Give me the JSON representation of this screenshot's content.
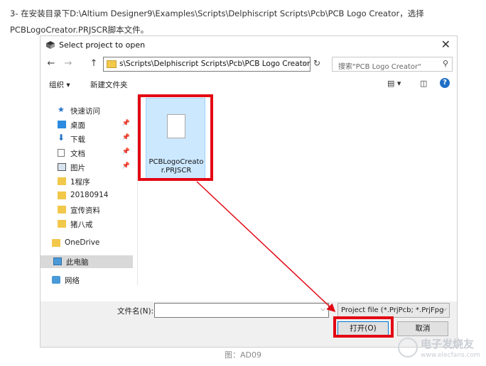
{
  "instruction": {
    "line1": "3- 在安装目录下D:\\Altium Designer9\\Examples\\Scripts\\Delphiscript Scripts\\Pcb\\PCB Logo Creator，选择",
    "line2": "PCBLogoCreator.PRJSCR脚本文件。"
  },
  "dialog": {
    "title": "Select project to open",
    "close_symbol": "✕",
    "nav": {
      "back": "←",
      "forward": "→",
      "up": "↑"
    },
    "address": "s\\Scripts\\Delphiscript Scripts\\Pcb\\PCB Logo Creator",
    "search_placeholder": "搜索\"PCB Logo Creator\"",
    "toolbar": {
      "organize": "组织 ▾",
      "new_folder": "新建文件夹",
      "help": "?"
    },
    "nav_items": [
      {
        "label": "快速访问",
        "icon": "star-icon",
        "pinned": false
      },
      {
        "label": "桌面",
        "icon": "desktop-icon",
        "pinned": true
      },
      {
        "label": "下载",
        "icon": "download-icon",
        "pinned": true
      },
      {
        "label": "文档",
        "icon": "document-icon",
        "pinned": true
      },
      {
        "label": "图片",
        "icon": "picture-icon",
        "pinned": true
      },
      {
        "label": "1程序",
        "icon": "folder-icon",
        "pinned": false
      },
      {
        "label": "20180914",
        "icon": "folder-icon",
        "pinned": false
      },
      {
        "label": "宣传资料",
        "icon": "folder-icon",
        "pinned": false
      },
      {
        "label": "猪八戒",
        "icon": "folder-icon",
        "pinned": false
      },
      {
        "label": "OneDrive",
        "icon": "onedrive-icon",
        "pinned": false
      },
      {
        "label": "此电脑",
        "icon": "computer-icon",
        "pinned": false,
        "selected": true
      },
      {
        "label": "网络",
        "icon": "network-icon",
        "pinned": false
      }
    ],
    "file": {
      "name": "PCBLogoCreator.PRJSCR"
    },
    "filename_label": "文件名(N):",
    "filename_value": "",
    "filetype": "Project file (*.PrjPcb; *.PrjFpg",
    "open_button": "打开(O)",
    "cancel_button": "取消"
  },
  "caption": "图：AD09",
  "watermark": {
    "title": "电子发烧友",
    "url": "www.elecfans.com"
  },
  "colors": {
    "highlight": "#e30613",
    "selected_tile": "#cce8ff"
  }
}
